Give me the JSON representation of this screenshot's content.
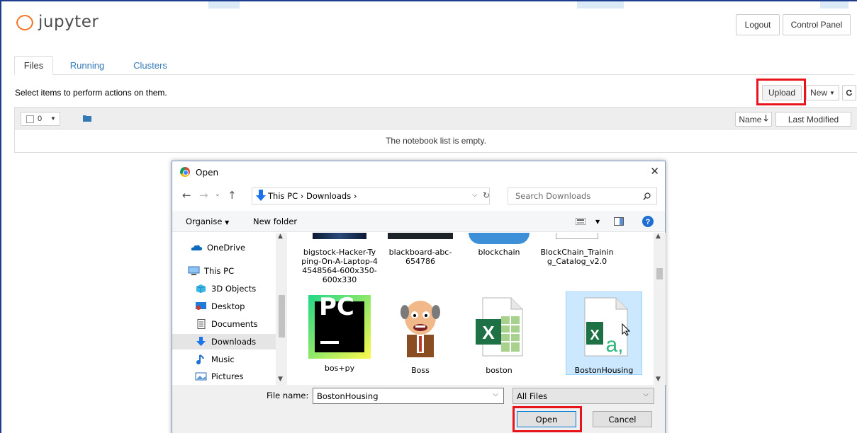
{
  "header": {
    "logo_text": "jupyter",
    "logout_label": "Logout",
    "control_panel_label": "Control Panel"
  },
  "tabs": [
    {
      "label": "Files",
      "active": true
    },
    {
      "label": "Running",
      "active": false
    },
    {
      "label": "Clusters",
      "active": false
    }
  ],
  "toolbar": {
    "hint": "Select items to perform actions on them.",
    "upload_label": "Upload",
    "new_label": "New",
    "refresh_icon": "refresh-icon"
  },
  "list": {
    "selected_count": "0",
    "sort_name_label": "Name",
    "last_modified_label": "Last Modified",
    "empty_message": "The notebook list is empty."
  },
  "dialog": {
    "title": "Open",
    "address_path": "This PC  ›  Downloads  ›",
    "search_placeholder": "Search Downloads",
    "organise_label": "Organise",
    "new_folder_label": "New folder",
    "nav_items": [
      {
        "label": "OneDrive",
        "icon": "cloud-icon"
      },
      {
        "label": "This PC",
        "icon": "computer-icon"
      },
      {
        "label": "3D Objects",
        "icon": "cube-icon"
      },
      {
        "label": "Desktop",
        "icon": "desktop-icon"
      },
      {
        "label": "Documents",
        "icon": "document-icon"
      },
      {
        "label": "Downloads",
        "icon": "download-icon",
        "selected": true
      },
      {
        "label": "Music",
        "icon": "music-icon"
      },
      {
        "label": "Pictures",
        "icon": "pictures-icon"
      }
    ],
    "files": [
      {
        "name": "bigstock-Hacker-Typing-On-A-Laptop-44548564-600x350-600x330"
      },
      {
        "name": "blackboard-abc-654786"
      },
      {
        "name": "blockchain"
      },
      {
        "name": "BlockChain_Training_Catalog_v2.0"
      },
      {
        "name": "bos+py"
      },
      {
        "name": "Boss"
      },
      {
        "name": "boston"
      },
      {
        "name": "BostonHousing",
        "selected": true
      }
    ],
    "file_name_label": "File name:",
    "file_name_value": "BostonHousing",
    "file_type_value": "All Files",
    "open_label": "Open",
    "cancel_label": "Cancel"
  },
  "colors": {
    "link_blue": "#337ab7",
    "highlight_red": "#e8141b",
    "jupyter_orange": "#f37626"
  }
}
